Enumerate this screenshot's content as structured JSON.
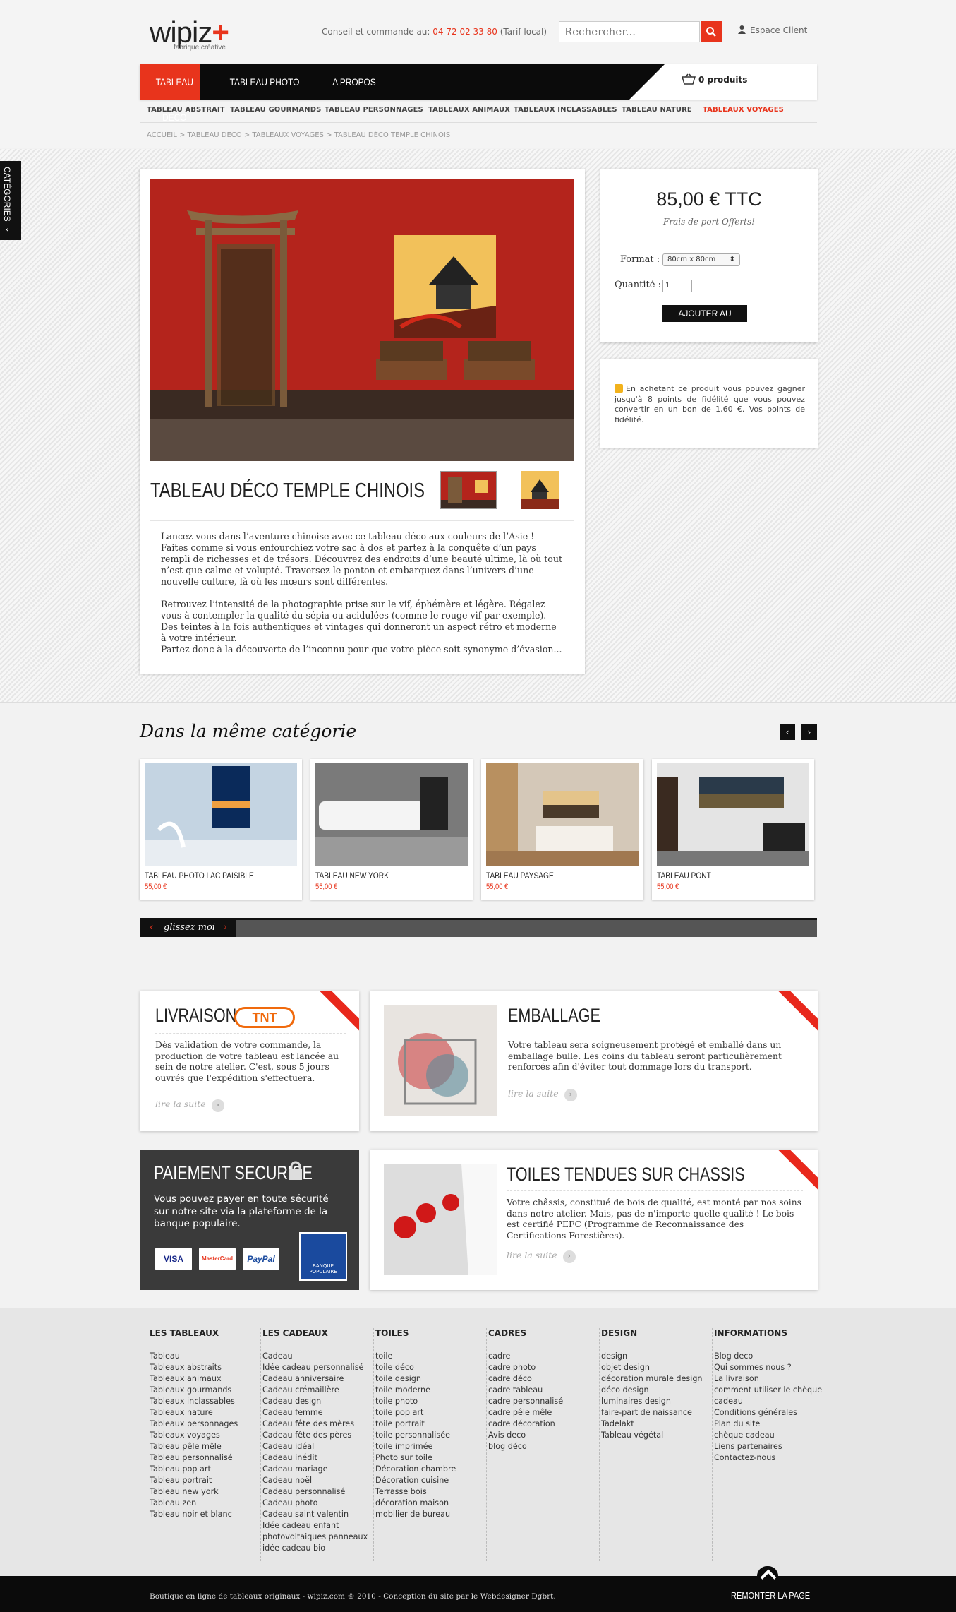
{
  "header": {
    "logo": "wipiz",
    "logo_sub": "fabrique créative",
    "contact_label": "Conseil et commande au:",
    "phone": "04 72 02 33 80",
    "tarif": "(Tarif local)",
    "search_placeholder": "Rechercher...",
    "client": "Espace Client"
  },
  "nav": {
    "items": [
      "TABLEAU DÉCO",
      "TABLEAU PHOTO",
      "A PROPOS"
    ],
    "cart": "0 produits"
  },
  "subnav": [
    "TABLEAU ABSTRAIT",
    "TABLEAU GOURMANDS",
    "TABLEAU PERSONNAGES",
    "TABLEAUX ANIMAUX",
    "TABLEAUX INCLASSABLES",
    "TABLEAU NATURE",
    "TABLEAUX VOYAGES"
  ],
  "breadcrumb": "ACCUEIL > TABLEAU DÉCO > TABLEAUX VOYAGES > TABLEAU DÉCO TEMPLE CHINOIS",
  "categories_tab": "CATÉGORIES",
  "product": {
    "title": "TABLEAU DÉCO TEMPLE CHINOIS",
    "desc1": "Lancez-vous dans l’aventure chinoise avec ce tableau déco aux couleurs de l’Asie ! Faites comme si vous enfourchiez votre sac à dos et partez à la conquête d’un pays rempli de richesses et de trésors. Découvrez des endroits d’une beauté ultime, là où tout n’est que calme et volupté. Traversez le ponton et embarquez dans l’univers d’une nouvelle culture, là où les mœurs sont différentes.",
    "desc2": "Retrouvez l’intensité de la photographie prise sur le vif, éphémère et légère. Régalez vous à contempler la qualité du sépia ou acidulées (comme le rouge vif par exemple). Des teintes à la fois authentiques et vintages qui donneront un aspect rétro et moderne à votre intérieur.",
    "desc3": "Partez donc à la découverte de l’inconnu pour que votre pièce soit synonyme d’évasion...",
    "price": "85,00 € TTC",
    "shipping": "Frais de port Offerts!",
    "format_label": "Format :",
    "format_value": "80cm x 80cm",
    "qty_label": "Quantité :",
    "qty_value": "1",
    "add_label": "AJOUTER AU PANIER",
    "fidelity": "En achetant ce produit vous pouvez gagner jusqu'à 8 points de fidélité que vous pouvez convertir en un bon de 1,60 €. Vos points de fidélité."
  },
  "same_cat": {
    "title": "Dans la même catégorie",
    "items": [
      {
        "name": "TABLEAU PHOTO LAC PAISIBLE",
        "price": "55,00 €"
      },
      {
        "name": "TABLEAU NEW YORK",
        "price": "55,00 €"
      },
      {
        "name": "TABLEAU PAYSAGE",
        "price": "55,00 €"
      },
      {
        "name": "TABLEAU PONT",
        "price": "55,00 €"
      }
    ],
    "slider": "glissez moi"
  },
  "infos": {
    "livraison": {
      "title": "LIVRAISON",
      "logo": "TNT",
      "text": "Dès validation de votre commande, la production de votre tableau est lancée au sein de notre atelier. C'est, sous 5 jours ouvrés que l'expédition s'effectuera.",
      "more": "lire la suite"
    },
    "emballage": {
      "title": "EMBALLAGE",
      "text": "Votre tableau sera soigneusement protégé et emballé dans un emballage bulle. Les coins du tableau seront particulièrement renforcés afin d'éviter tout dommage lors du transport.",
      "more": "lire la suite"
    },
    "paiement": {
      "title": "PAIEMENT SECURISE",
      "text": "Vous pouvez payer en toute sécurité sur notre site via la plateforme de la banque populaire.",
      "cards": [
        "VISA",
        "MasterCard",
        "PayPal"
      ],
      "bank": "BANQUE POPULAIRE"
    },
    "toiles": {
      "title": "TOILES TENDUES SUR CHASSIS",
      "text": "Votre châssis, constitué de bois de qualité, est monté par nos soins dans notre atelier. Mais, pas de n'importe quelle qualité ! Le bois est certifié PEFC (Programme de Reconnaissance des Certifications Forestières).",
      "more": "lire la suite"
    }
  },
  "footer": {
    "cols": [
      {
        "title": "LES TABLEAUX",
        "links": [
          "Tableau",
          "Tableaux abstraits",
          "Tableaux animaux",
          "Tableaux gourmands",
          "Tableaux inclassables",
          "Tableaux nature",
          "Tableaux personnages",
          "Tableaux voyages",
          "Tableau pêle mêle",
          "Tableau personnalisé",
          "Tableau pop art",
          "Tableau portrait",
          "Tableau new york",
          "Tableau zen",
          "Tableau noir et blanc"
        ]
      },
      {
        "title": "LES CADEAUX",
        "links": [
          "Cadeau",
          "Idée cadeau personnalisé",
          "Cadeau anniversaire",
          "Cadeau crémaillère",
          "Cadeau design",
          "Cadeau femme",
          "Cadeau fête des mères",
          "Cadeau fête des pères",
          "Cadeau idéal",
          "Cadeau inédit",
          "Cadeau mariage",
          "Cadeau noël",
          "Cadeau personnalisé",
          "Cadeau photo",
          "Cadeau saint valentin",
          "Idée cadeau enfant",
          "photovoltaiques panneaux",
          "idée cadeau bio"
        ]
      },
      {
        "title": "TOILES",
        "links": [
          "toile",
          "toile déco",
          "toile design",
          "toile moderne",
          "toile photo",
          "toile pop art",
          "toile portrait",
          "toile personnalisée",
          "toile imprimée",
          "Photo sur toile",
          "Décoration chambre",
          "Décoration cuisine",
          "Terrasse bois",
          "décoration maison",
          "mobilier de bureau"
        ]
      },
      {
        "title": "CADRES",
        "links": [
          "cadre",
          "cadre photo",
          "cadre déco",
          "cadre tableau",
          "cadre personnalisé",
          "cadre pêle mêle",
          "cadre décoration",
          "Avis deco",
          "blog déco"
        ]
      },
      {
        "title": "DESIGN",
        "links": [
          "design",
          "objet design",
          "décoration murale design",
          "déco design",
          "luminaires design",
          "faire-part de naissance",
          "Tadelakt",
          "Tableau végétal"
        ]
      },
      {
        "title": "INFORMATIONS",
        "links": [
          "Blog deco",
          "Qui sommes nous ?",
          "La livraison",
          "comment utiliser le chèque cadeau",
          "Conditions générales",
          "Plan du site",
          "chèque cadeau",
          "Liens partenaires",
          "Contactez-nous"
        ]
      }
    ],
    "copyright": "Boutique en ligne de tableaux originaux - wipiz.com © 2010 - Conception du site par le Webdesigner Dgbrt.",
    "back_top": "REMONTER LA PAGE"
  }
}
